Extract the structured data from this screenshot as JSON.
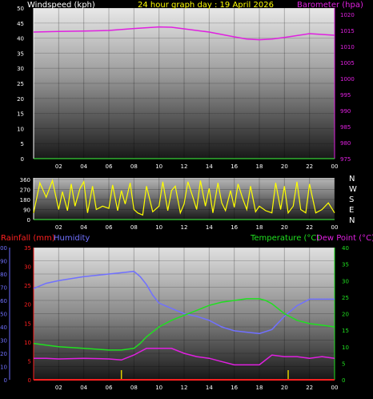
{
  "chart_data": [
    {
      "type": "line",
      "title": "24 hour graph day : 19 April 2026",
      "ylabel_left": "Windspeed (kph)",
      "ylabel_right": "Barometer (hpa)",
      "ylim_left": [
        0,
        50
      ],
      "ylim_right": [
        975,
        1020
      ],
      "y_ticks_left": [
        "0",
        "5",
        "10",
        "15",
        "20",
        "25",
        "30",
        "35",
        "40",
        "45",
        "50"
      ],
      "y_ticks_right": [
        "975",
        "980",
        "985",
        "990",
        "995",
        "1000",
        "1005",
        "1010",
        "1015",
        "1020"
      ],
      "x_ticks": [
        "02",
        "04",
        "06",
        "08",
        "10",
        "12",
        "14",
        "16",
        "18",
        "20",
        "22",
        "00"
      ],
      "grid": true,
      "colors": {
        "barometer": "#e020e0",
        "windspeed": "#40a0ff",
        "title": "#ffff00",
        "left_label": "#ffffff",
        "right_label": "#e020e0",
        "x_axis": "#40ff40"
      },
      "series": [
        {
          "name": "Barometer (hpa)",
          "axis": "right",
          "x": [
            0,
            2,
            4,
            6,
            8,
            10,
            11,
            12,
            14,
            16,
            17,
            18,
            19,
            20,
            22,
            24
          ],
          "values": [
            1014.5,
            1014.7,
            1014.8,
            1015.0,
            1015.6,
            1016.1,
            1016.0,
            1015.5,
            1014.5,
            1013.0,
            1012.3,
            1012.1,
            1012.3,
            1012.8,
            1014.0,
            1013.5
          ]
        }
      ]
    },
    {
      "type": "line",
      "ylabel_right": [
        "N",
        "W",
        "S",
        "E",
        "N"
      ],
      "ylim": [
        0,
        360
      ],
      "y_ticks": [
        "0",
        "90",
        "180",
        "270",
        "360"
      ],
      "x_ticks": [
        "02",
        "04",
        "06",
        "08",
        "10",
        "12",
        "14",
        "16",
        "18",
        "20",
        "22",
        "00"
      ],
      "colors": {
        "direction": "#ffff00",
        "compass": "#ffffff"
      },
      "series": [
        {
          "name": "Wind direction",
          "x": [
            0,
            0.5,
            1,
            1.5,
            2,
            2.3,
            2.7,
            3,
            3.3,
            3.7,
            4,
            4.3,
            4.7,
            5,
            5.5,
            6,
            6.3,
            6.7,
            7,
            7.3,
            7.7,
            8,
            8.3,
            8.7,
            9,
            9.5,
            10,
            10.3,
            10.7,
            11,
            11.3,
            11.7,
            12,
            12.3,
            12.7,
            13,
            13.3,
            13.7,
            14,
            14.3,
            14.7,
            15,
            15.3,
            15.7,
            16,
            16.3,
            16.7,
            17,
            17.3,
            17.7,
            18,
            18.5,
            19,
            19.3,
            19.7,
            20,
            20.3,
            20.7,
            21,
            21.3,
            21.7,
            22,
            22.5,
            23,
            23.5,
            24
          ],
          "values": [
            60,
            330,
            200,
            350,
            90,
            250,
            80,
            320,
            120,
            280,
            340,
            60,
            300,
            90,
            120,
            100,
            310,
            80,
            260,
            140,
            330,
            90,
            60,
            40,
            300,
            70,
            120,
            340,
            80,
            260,
            300,
            60,
            140,
            340,
            200,
            90,
            350,
            120,
            280,
            60,
            330,
            150,
            80,
            260,
            110,
            320,
            180,
            90,
            300,
            70,
            120,
            80,
            60,
            330,
            90,
            300,
            60,
            120,
            340,
            90,
            60,
            320,
            60,
            90,
            150,
            60
          ]
        }
      ]
    },
    {
      "type": "line",
      "legend": [
        "Rainfall (mm)",
        "Humidity",
        "Temperature (°C)",
        "Dew Point (°C)"
      ],
      "ylim_humidity": [
        0,
        100
      ],
      "ylim_rain": [
        0,
        35
      ],
      "ylim_temp": [
        0,
        40
      ],
      "y_ticks_humidity": [
        "0",
        "10",
        "20",
        "30",
        "40",
        "50",
        "60",
        "70",
        "80",
        "90",
        "100"
      ],
      "y_ticks_rain": [
        "0",
        "5",
        "10",
        "15",
        "20",
        "25",
        "30",
        "35"
      ],
      "y_ticks_temp": [
        "0",
        "5",
        "10",
        "15",
        "20",
        "25",
        "30",
        "35",
        "40"
      ],
      "x_ticks": [
        "02",
        "04",
        "06",
        "08",
        "10",
        "12",
        "14",
        "16",
        "18",
        "20",
        "22",
        "00"
      ],
      "colors": {
        "rainfall": "#ff2020",
        "humidity": "#7070ff",
        "temperature": "#20e020",
        "dewpoint": "#e020e0",
        "rain_marker": "#e0d000"
      },
      "series": [
        {
          "name": "Humidity",
          "axis": "humidity",
          "x": [
            0,
            1,
            2,
            4,
            6,
            7,
            8,
            8.5,
            9,
            9.5,
            10,
            11,
            12,
            13,
            14,
            15,
            16,
            17,
            18,
            19,
            20,
            21,
            22,
            23,
            24
          ],
          "values": [
            69,
            73,
            75,
            78,
            80,
            81,
            82,
            78,
            72,
            64,
            58,
            54,
            50,
            48,
            45,
            40,
            37,
            36,
            35,
            38,
            48,
            56,
            61,
            61,
            61
          ]
        },
        {
          "name": "Temperature (°C)",
          "axis": "temp",
          "x": [
            0,
            1,
            2,
            4,
            6,
            7,
            8,
            8.5,
            9,
            10,
            11,
            12,
            13,
            14,
            15,
            16,
            17,
            18,
            18.5,
            19,
            20,
            21,
            22,
            23,
            24
          ],
          "values": [
            11,
            10.5,
            10,
            9.5,
            9,
            9,
            9.5,
            11,
            13,
            16,
            18,
            19.5,
            21,
            22.5,
            23.5,
            24,
            24.5,
            24.5,
            24,
            23,
            20,
            18,
            17,
            16.5,
            16
          ]
        },
        {
          "name": "Dew Point (°C)",
          "axis": "temp",
          "x": [
            0,
            1,
            2,
            4,
            6,
            7,
            8,
            8.5,
            9,
            10,
            11,
            12,
            13,
            14,
            15,
            16,
            17,
            18,
            19,
            20,
            21,
            22,
            23,
            24
          ],
          "values": [
            6.5,
            6.5,
            6.3,
            6.5,
            6.3,
            6,
            7.5,
            8.5,
            9.5,
            9.5,
            9.5,
            8,
            7,
            6.5,
            5.5,
            4.5,
            4.5,
            4.5,
            7.5,
            7,
            7,
            6.5,
            7,
            6.5
          ]
        },
        {
          "name": "Rainfall (mm)",
          "axis": "rain",
          "x": [
            0,
            24
          ],
          "values": [
            0,
            0
          ]
        }
      ]
    }
  ]
}
